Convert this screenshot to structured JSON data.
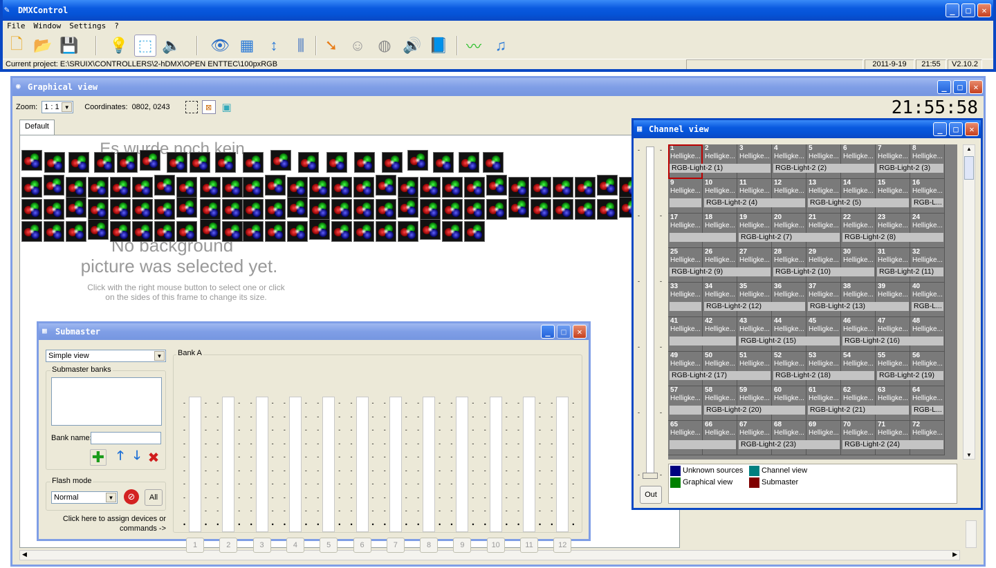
{
  "app": {
    "title": "DMXControl"
  },
  "menu": [
    "File",
    "Window",
    "Settings",
    "?"
  ],
  "toolbar_icons": [
    "new-file-icon",
    "open-folder-icon",
    "save-icon",
    "bulb-icon",
    "cube-icon",
    "speaker-stop-icon",
    "eye-icon",
    "table-icon",
    "up-down-arrow-icon",
    "sliders-icon",
    "ray-arrow-icon",
    "masks-icon",
    "cd-icon",
    "speaker-icon",
    "book-icon",
    "waveform-icon",
    "music-note-icon"
  ],
  "status": {
    "project": "Current project: E:\\SRUIX\\CONTROLLERS\\2-hDMX\\OPEN ENTTEC\\100pxRGB",
    "date": "2011-9-19",
    "time": "21:55",
    "version": "V2.10.2"
  },
  "graphical": {
    "title": "Graphical view",
    "zoom_label": "Zoom:",
    "zoom_value": "1 : 1",
    "coords_label": "Coordinates:",
    "coords_value": "0802, 0243",
    "clock": "21:55:58",
    "tab": "Default",
    "bg_msg_de": "Es wurde noch kein",
    "bg_msg_line1": "No background",
    "bg_msg_line2": "picture was selected yet.",
    "bg_hint1": "Click with the right mouse button to select one or click",
    "bg_hint2": "on the sides of this frame to change its size."
  },
  "submaster": {
    "title": "Submaster",
    "view_select": "Simple view",
    "banks_label": "Submaster banks",
    "bank_name_label": "Bank name:",
    "flash_label": "Flash mode",
    "flash_value": "Normal",
    "all_label": "All",
    "assign_text1": "Click here to assign devices or",
    "assign_text2": "commands ->",
    "bank_label": "Bank A",
    "faders": [
      "1",
      "2",
      "3",
      "4",
      "5",
      "6",
      "7",
      "8",
      "9",
      "10",
      "11",
      "12"
    ]
  },
  "channel": {
    "title": "Channel view",
    "out_label": "Out",
    "cell_label": "Helligke...",
    "cells": [
      "1",
      "2",
      "3",
      "4",
      "5",
      "6",
      "7",
      "8",
      "9",
      "10",
      "11",
      "12",
      "13",
      "14",
      "15",
      "16",
      "17",
      "18",
      "19",
      "20",
      "21",
      "22",
      "23",
      "24",
      "25",
      "26",
      "27",
      "28",
      "29",
      "30",
      "31",
      "32",
      "33",
      "34",
      "35",
      "36",
      "37",
      "38",
      "39",
      "40",
      "41",
      "42",
      "43",
      "44",
      "45",
      "46",
      "47",
      "48",
      "49",
      "50",
      "51",
      "52",
      "53",
      "54",
      "55",
      "56",
      "57",
      "58",
      "59",
      "60",
      "61",
      "62",
      "63",
      "64",
      "65",
      "66",
      "67",
      "68",
      "69",
      "70",
      "71",
      "72"
    ],
    "devices": [
      {
        "row": 0,
        "col": 0,
        "span": 3,
        "label": "RGB-Light-2 (1)"
      },
      {
        "row": 0,
        "col": 3,
        "span": 3,
        "label": "RGB-Light-2 (2)"
      },
      {
        "row": 0,
        "col": 6,
        "span": 2,
        "label": "RGB-Light-2 (3)"
      },
      {
        "row": 1,
        "col": 1,
        "span": 3,
        "label": "RGB-Light-2 (4)"
      },
      {
        "row": 1,
        "col": 4,
        "span": 3,
        "label": "RGB-Light-2 (5)"
      },
      {
        "row": 1,
        "col": 7,
        "span": 1,
        "label": "RGB-L..."
      },
      {
        "row": 2,
        "col": 2,
        "span": 3,
        "label": "RGB-Light-2 (7)"
      },
      {
        "row": 2,
        "col": 5,
        "span": 3,
        "label": "RGB-Light-2 (8)"
      },
      {
        "row": 3,
        "col": 0,
        "span": 3,
        "label": "RGB-Light-2 (9)"
      },
      {
        "row": 3,
        "col": 3,
        "span": 3,
        "label": "RGB-Light-2 (10)"
      },
      {
        "row": 3,
        "col": 6,
        "span": 2,
        "label": "RGB-Light-2 (11)"
      },
      {
        "row": 4,
        "col": 1,
        "span": 3,
        "label": "RGB-Light-2 (12)"
      },
      {
        "row": 4,
        "col": 4,
        "span": 3,
        "label": "RGB-Light-2 (13)"
      },
      {
        "row": 4,
        "col": 7,
        "span": 1,
        "label": "RGB-L..."
      },
      {
        "row": 5,
        "col": 2,
        "span": 3,
        "label": "RGB-Light-2 (15)"
      },
      {
        "row": 5,
        "col": 5,
        "span": 3,
        "label": "RGB-Light-2 (16)"
      },
      {
        "row": 6,
        "col": 0,
        "span": 3,
        "label": "RGB-Light-2 (17)"
      },
      {
        "row": 6,
        "col": 3,
        "span": 3,
        "label": "RGB-Light-2 (18)"
      },
      {
        "row": 6,
        "col": 6,
        "span": 2,
        "label": "RGB-Light-2 (19)"
      },
      {
        "row": 7,
        "col": 1,
        "span": 3,
        "label": "RGB-Light-2 (20)"
      },
      {
        "row": 7,
        "col": 4,
        "span": 3,
        "label": "RGB-Light-2 (21)"
      },
      {
        "row": 7,
        "col": 7,
        "span": 1,
        "label": "RGB-L..."
      },
      {
        "row": 8,
        "col": 2,
        "span": 3,
        "label": "RGB-Light-2 (23)"
      },
      {
        "row": 8,
        "col": 5,
        "span": 3,
        "label": "RGB-Light-2 (24)"
      }
    ],
    "continuation_rows": [
      1,
      2,
      4,
      5,
      7,
      8
    ],
    "legend": [
      {
        "label": "Unknown sources",
        "color": "#000080"
      },
      {
        "label": "Channel view",
        "color": "#008080"
      },
      {
        "label": "Graphical view",
        "color": "#008000"
      },
      {
        "label": "Submaster",
        "color": "#800000"
      }
    ]
  }
}
